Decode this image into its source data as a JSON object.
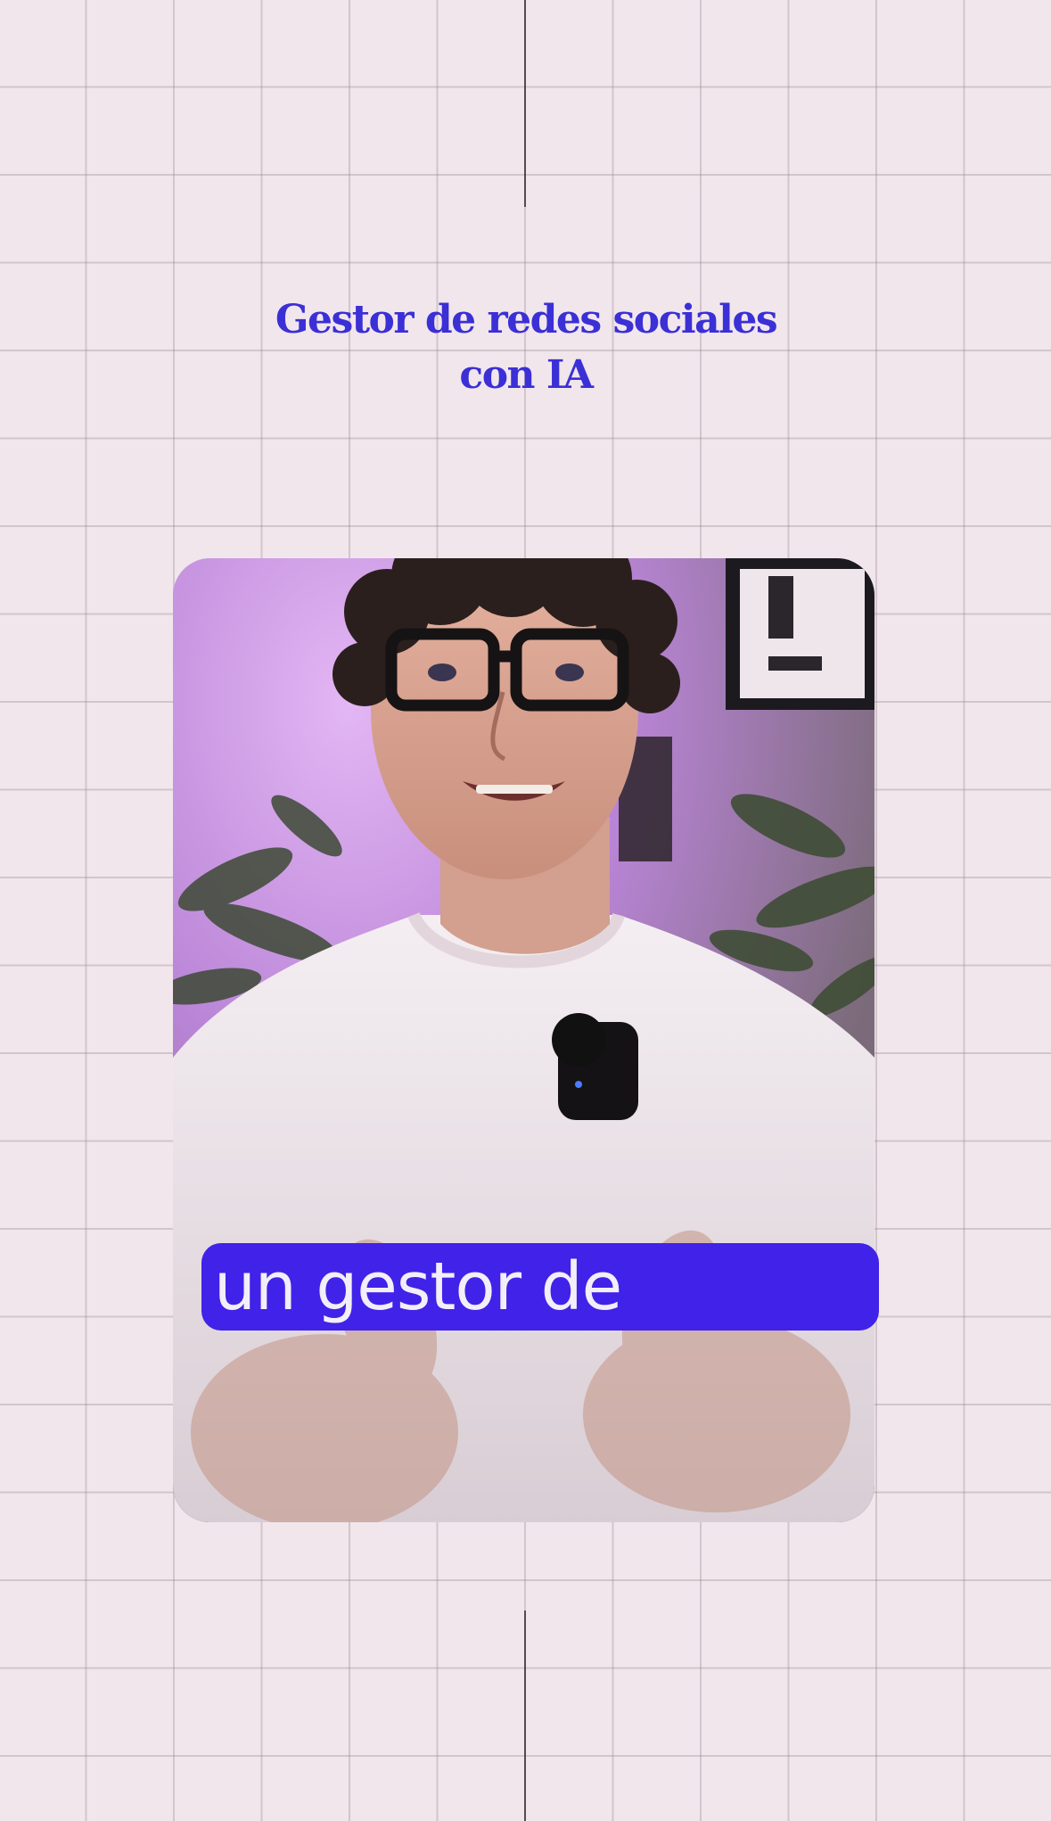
{
  "headline": {
    "line1": "Gestor de redes sociales",
    "line2": "con IA"
  },
  "caption": {
    "text": "un gestor de"
  },
  "colors": {
    "background": "#f1e6ec",
    "grid_line": "#c9b9c1",
    "headline": "#3b2fd6",
    "caption_box": "#4022e8",
    "caption_text": "#f3eef8"
  }
}
